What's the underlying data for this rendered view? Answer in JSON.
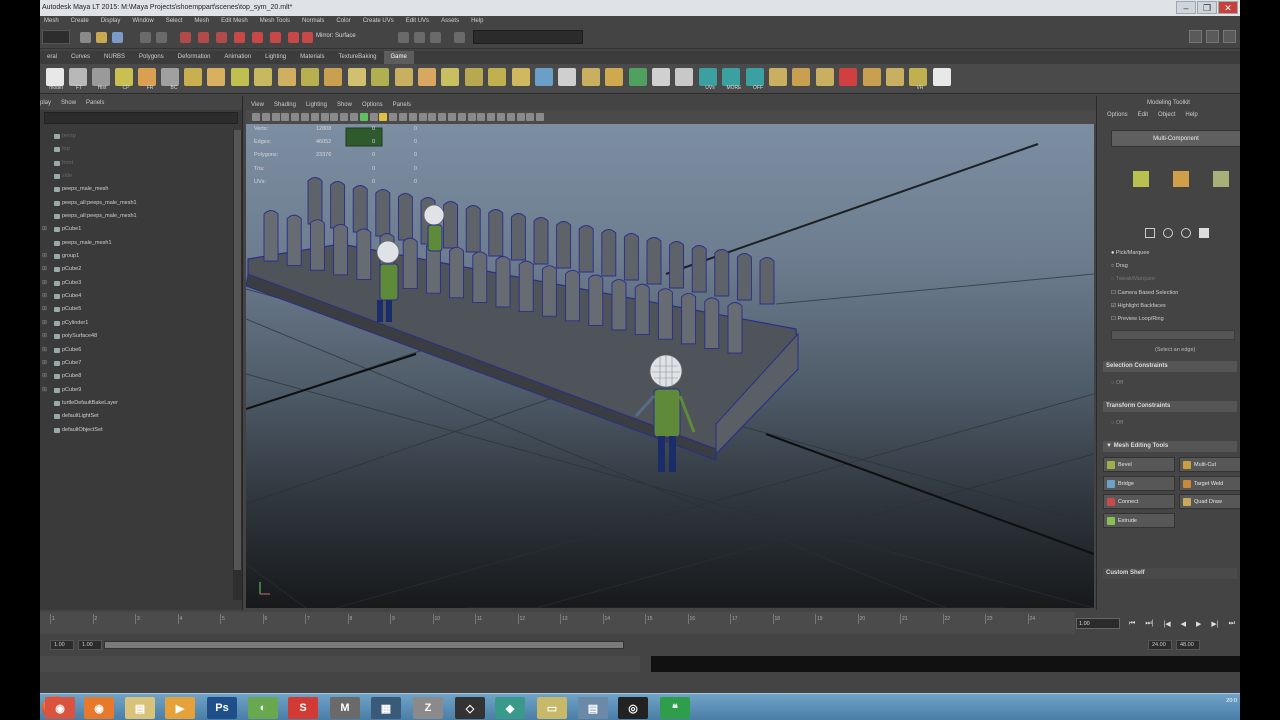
{
  "window": {
    "title": "Autodesk Maya LT 2015: M:\\Maya Projects\\shoemppart\\scenes\\top_sym_20.mlt*",
    "controls": [
      "–",
      "❐",
      "✕"
    ]
  },
  "menubar": [
    "Mesh",
    "Create",
    "Display",
    "Window",
    "Select",
    "Mesh",
    "Edit Mesh",
    "Mesh Tools",
    "Normals",
    "Color",
    "Create UVs",
    "Edit UVs",
    "Assets",
    "Help"
  ],
  "status_line": {
    "symmetry_label": "Mirror: Surface"
  },
  "shelf_tabs": {
    "items": [
      "eral",
      "Curves",
      "NURBS",
      "Polygons",
      "Deformation",
      "Animation",
      "Lighting",
      "Materials",
      "TextureBaking",
      "Game"
    ],
    "active_index": 9
  },
  "shelf_labels": [
    "model",
    "FT",
    "Hist",
    "CP",
    "FR",
    "BC",
    "UVs",
    "MORE",
    "OFF",
    "VR"
  ],
  "outliner": {
    "menu": [
      "play",
      "Show",
      "Panels"
    ],
    "items": [
      {
        "label": "persp",
        "dim": true
      },
      {
        "label": "top",
        "dim": true
      },
      {
        "label": "front",
        "dim": true
      },
      {
        "label": "side",
        "dim": true
      },
      {
        "label": "peeps_male_mesh",
        "dim": false
      },
      {
        "label": "peeps_all:peeps_male_mesh1",
        "dim": false
      },
      {
        "label": "peeps_all:peeps_male_mesh1",
        "dim": false
      },
      {
        "label": "pCube1",
        "dim": false
      },
      {
        "label": "peeps_male_mesh1",
        "dim": false
      },
      {
        "label": "group1",
        "dim": false
      },
      {
        "label": "pCube2",
        "dim": false
      },
      {
        "label": "pCube3",
        "dim": false
      },
      {
        "label": "pCube4",
        "dim": false
      },
      {
        "label": "pCube5",
        "dim": false
      },
      {
        "label": "pCylinder1",
        "dim": false
      },
      {
        "label": "polySurface48",
        "dim": false
      },
      {
        "label": "pCube6",
        "dim": false
      },
      {
        "label": "pCube7",
        "dim": false
      },
      {
        "label": "pCube8",
        "dim": false
      },
      {
        "label": "pCube9",
        "dim": false
      },
      {
        "label": "turtleDefaultBakeLayer",
        "dim": false
      },
      {
        "label": "defaultLightSet",
        "dim": false
      },
      {
        "label": "defaultObjectSet",
        "dim": false
      }
    ]
  },
  "viewport": {
    "menu": [
      "View",
      "Shading",
      "Lighting",
      "Show",
      "Options",
      "Panels"
    ],
    "hud": [
      {
        "label": "Verts:",
        "v1": "12808",
        "v2": "0",
        "v3": "0"
      },
      {
        "label": "Edges:",
        "v1": "46052",
        "v2": "0",
        "v3": "0"
      },
      {
        "label": "Polygons:",
        "v1": "23376",
        "v2": "0",
        "v3": "0"
      },
      {
        "label": "Tris:",
        "v1": "",
        "v2": "0",
        "v3": "0"
      },
      {
        "label": "UVs:",
        "v1": "",
        "v2": "0",
        "v3": "0"
      }
    ]
  },
  "modeling_toolkit": {
    "title": "Modeling Toolkit",
    "menu": [
      "Options",
      "Edit",
      "Object",
      "Help"
    ],
    "multi_component": "Multi-Component",
    "pick_options": [
      "Pick/Marquee",
      "Drag",
      "Tweak/Marquee",
      "Camera Based Selection",
      "Highlight Backfaces",
      "Preview Loop/Ring"
    ],
    "select_hint": "(Select an edge)",
    "sections": [
      "Selection Constraints",
      "Transform Constraints",
      "Mesh Editing Tools",
      "Custom Shelf"
    ],
    "off_label": "Off",
    "tools": [
      {
        "label": "Bevel",
        "color": "#9fb04a"
      },
      {
        "label": "Multi-Cut",
        "color": "#c9a040"
      },
      {
        "label": "Bridge",
        "color": "#6aa2c8"
      },
      {
        "label": "Target Weld",
        "color": "#c88a3a"
      },
      {
        "label": "Connect",
        "color": "#c84a4a"
      },
      {
        "label": "Quad Draw",
        "color": "#c8a85a"
      },
      {
        "label": "Extrude",
        "color": "#8ac050"
      }
    ]
  },
  "time_slider": {
    "tick_labels": [
      "1",
      "2",
      "3",
      "4",
      "5",
      "6",
      "7",
      "8",
      "9",
      "10",
      "11",
      "12",
      "13",
      "14",
      "15",
      "16",
      "17",
      "18",
      "19",
      "20",
      "21",
      "22",
      "23",
      "24"
    ],
    "current_frame": "1.00",
    "playback": [
      "⏮",
      "⏭|",
      "|◀",
      "◀",
      "▶",
      "▶|",
      "⏭"
    ]
  },
  "range_slider": {
    "start": "1.00",
    "start2": "1.00",
    "end": "24.00",
    "end2": "48.00"
  },
  "taskbar": {
    "apps": [
      {
        "name": "chrome",
        "glyph": "◉",
        "bg": "#d9533f"
      },
      {
        "name": "firefox",
        "glyph": "◉",
        "bg": "#e8792b"
      },
      {
        "name": "folder",
        "glyph": "▤",
        "bg": "#d9c27a"
      },
      {
        "name": "media",
        "glyph": "▶",
        "bg": "#e6a23a"
      },
      {
        "name": "photoshop",
        "glyph": "Ps",
        "bg": "#1f4f8a"
      },
      {
        "name": "greenapp",
        "glyph": "◐",
        "bg": "#6aa84f"
      },
      {
        "name": "sketchbook",
        "glyph": "S",
        "bg": "#d13b34"
      },
      {
        "name": "maya",
        "glyph": "M",
        "bg": "#6a6a6a"
      },
      {
        "name": "notes",
        "glyph": "▦",
        "bg": "#3a5a7a"
      },
      {
        "name": "zbrush",
        "glyph": "Z",
        "bg": "#8a8a8a"
      },
      {
        "name": "unity",
        "glyph": "◇",
        "bg": "#333"
      },
      {
        "name": "mudbox",
        "glyph": "◆",
        "bg": "#3a9a8a"
      },
      {
        "name": "explorer",
        "glyph": "▭",
        "bg": "#c8b86a"
      },
      {
        "name": "viewer",
        "glyph": "▤",
        "bg": "#6a8aa8"
      },
      {
        "name": "steam",
        "glyph": "◎",
        "bg": "#222"
      },
      {
        "name": "hangouts",
        "glyph": "❝",
        "bg": "#2e9e4a"
      }
    ],
    "clock": "20:0"
  }
}
